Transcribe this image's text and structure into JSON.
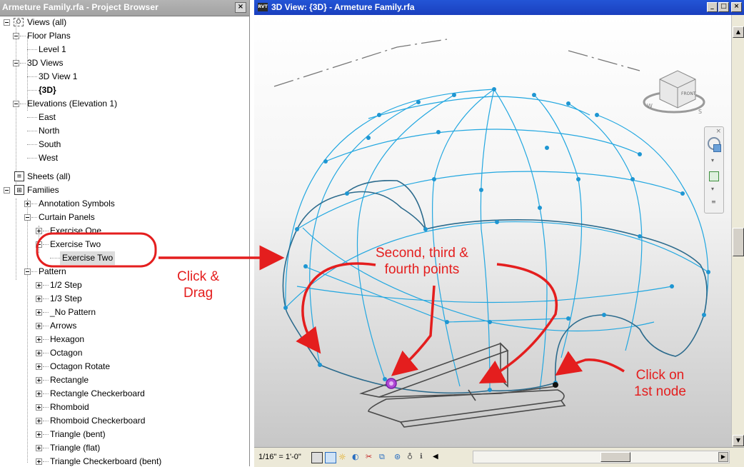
{
  "project_browser": {
    "title": "Armeture Family.rfa - Project Browser",
    "close_glyph": "×",
    "tree": {
      "views_all": "Views (all)",
      "floor_plans": "Floor Plans",
      "level_1": "Level 1",
      "views_3d": "3D Views",
      "view_3d_1": "3D View 1",
      "view_3d_current": "{3D}",
      "elevations": "Elevations (Elevation 1)",
      "east": "East",
      "north": "North",
      "south": "South",
      "west": "West",
      "sheets_all": "Sheets (all)",
      "families": "Families",
      "annotation_symbols": "Annotation Symbols",
      "curtain_panels": "Curtain Panels",
      "exercise_one": "Exercise One",
      "exercise_two": "Exercise Two",
      "exercise_two_type": "Exercise Two",
      "pattern": "Pattern",
      "patterns": [
        "1/2 Step",
        "1/3 Step",
        "_No Pattern",
        "Arrows",
        "Hexagon",
        "Octagon",
        "Octagon Rotate",
        "Rectangle",
        "Rectangle Checkerboard",
        "Rhomboid",
        "Rhomboid Checkerboard",
        "Triangle (bent)",
        "Triangle (flat)",
        "Triangle Checkerboard (bent)"
      ]
    }
  },
  "view_window": {
    "title": "3D View: {3D} - Armeture Family.rfa",
    "app_icon_label": "RVT",
    "minimize_glyph": "_",
    "restore_glyph": "□",
    "close_glyph": "×",
    "viewcube_face": "FRONT",
    "scale": "1/16\" = 1'-0\""
  },
  "annotations": {
    "click_drag": "Click &\nDrag",
    "points": "Second, third &\nfourth points",
    "first_node": "Click on\n1st node"
  },
  "colors": {
    "annotation_red": "#e41e1e",
    "wireframe_blue": "#22a7e0",
    "titlebar_blue": "#1a3fbe"
  }
}
